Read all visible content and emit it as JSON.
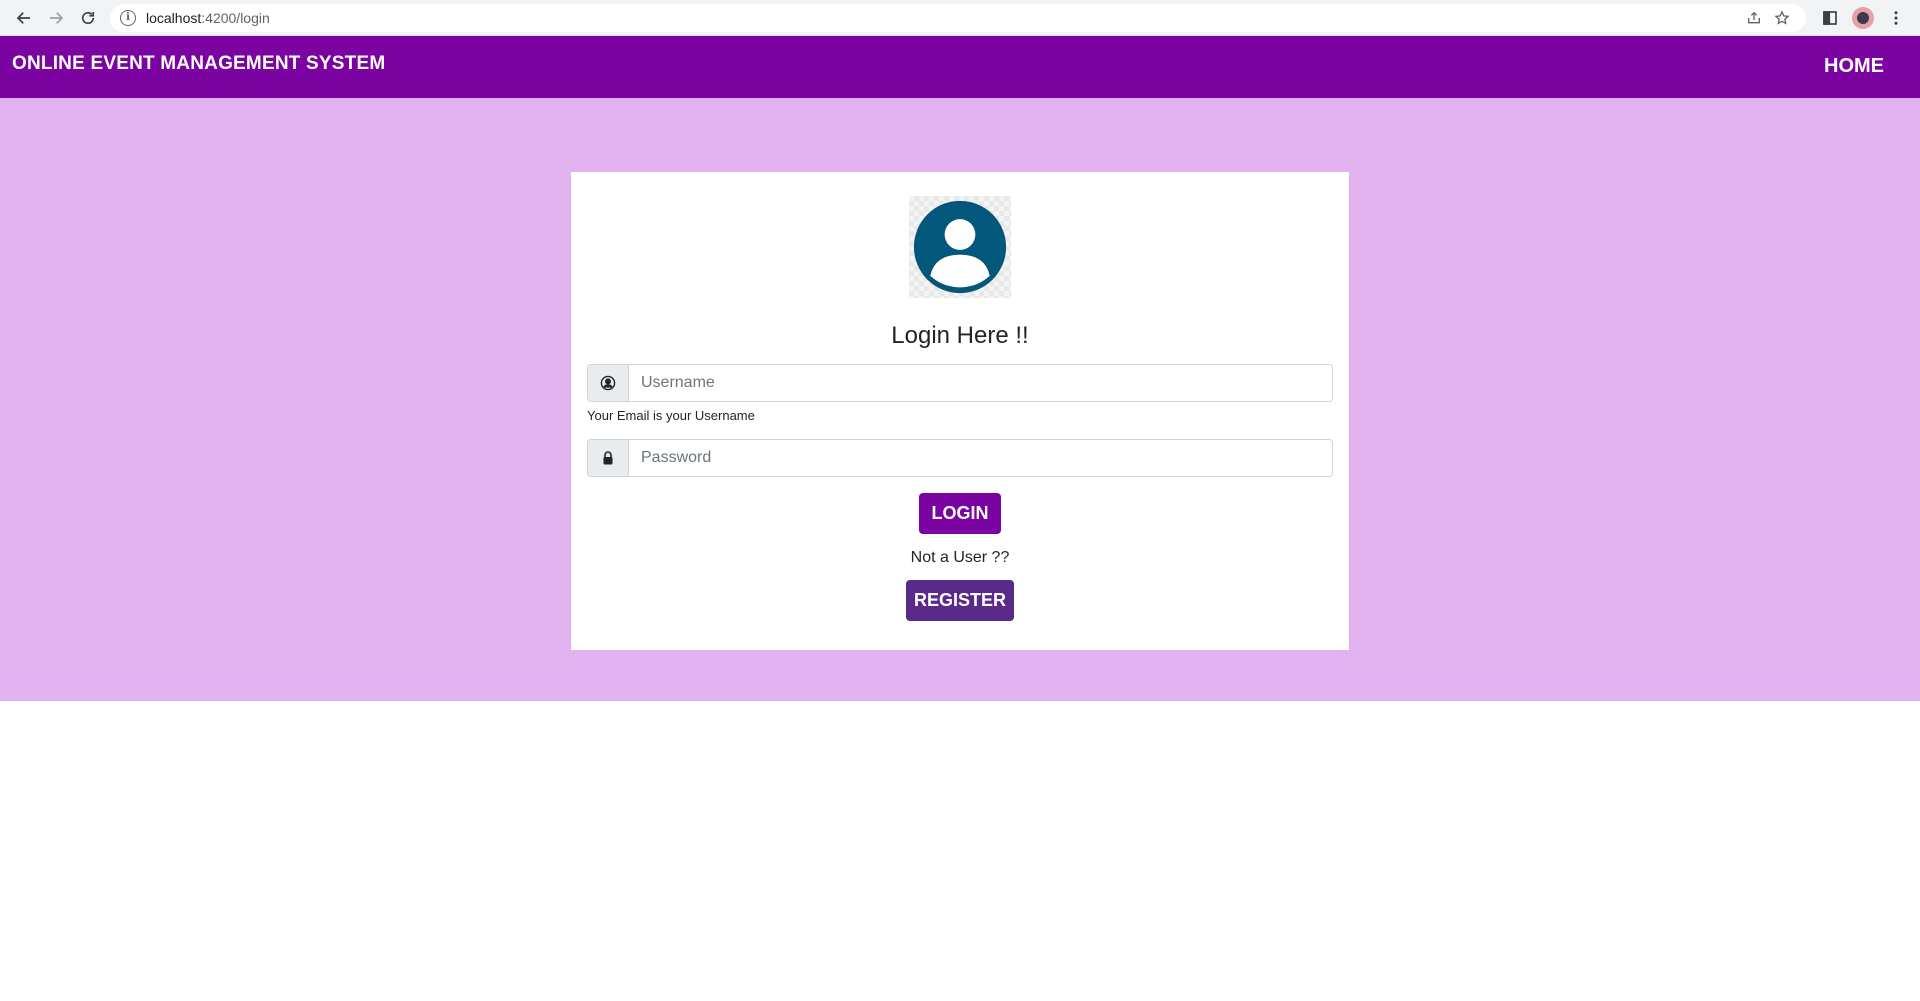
{
  "browser": {
    "url_host": "localhost",
    "url_path": ":4200/login"
  },
  "navbar": {
    "brand": "ONLINE EVENT MANAGEMENT SYSTEM",
    "home_label": "HOME",
    "background_color": "#7b03a1"
  },
  "page": {
    "background_color": "#e2b1f0"
  },
  "login_card": {
    "avatar_icon": "user-circle-icon",
    "avatar_color": "#02577a",
    "title": "Login Here !!",
    "username": {
      "icon": "user-circle-icon",
      "placeholder": "Username",
      "value": "",
      "help_text": "Your Email is your Username"
    },
    "password": {
      "icon": "lock-icon",
      "placeholder": "Password",
      "value": ""
    },
    "login_button": "LOGIN",
    "not_user_text": "Not a User ??",
    "register_button": "REGISTER"
  }
}
